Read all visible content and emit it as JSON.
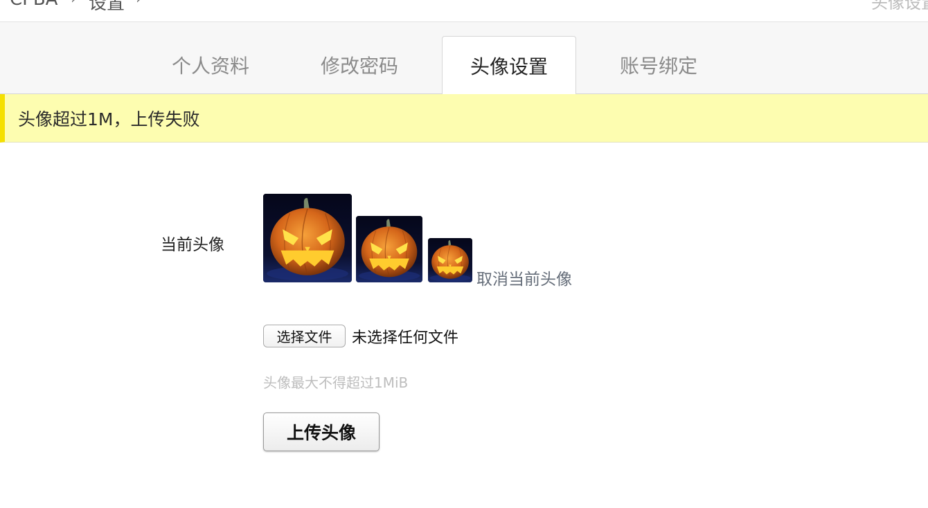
{
  "breadcrumb": {
    "items": [
      "CPBA",
      "设置"
    ],
    "separator": "›",
    "right_text": "头像设置"
  },
  "tabs": [
    {
      "label": "个人资料",
      "active": false
    },
    {
      "label": "修改密码",
      "active": false
    },
    {
      "label": "头像设置",
      "active": true
    },
    {
      "label": "账号绑定",
      "active": false
    }
  ],
  "alert": {
    "message": "头像超过1M，上传失败",
    "background": "#fdfdb0",
    "accent": "#f5e000"
  },
  "avatar": {
    "label": "当前头像",
    "previews": [
      "pumpkin-avatar-large",
      "pumpkin-avatar-medium",
      "pumpkin-avatar-small"
    ],
    "cancel_label": "取消当前头像"
  },
  "upload": {
    "choose_file_label": "选择文件",
    "file_status": "未选择任何文件",
    "hint": "头像最大不得超过1MiB",
    "submit_label": "上传头像"
  }
}
